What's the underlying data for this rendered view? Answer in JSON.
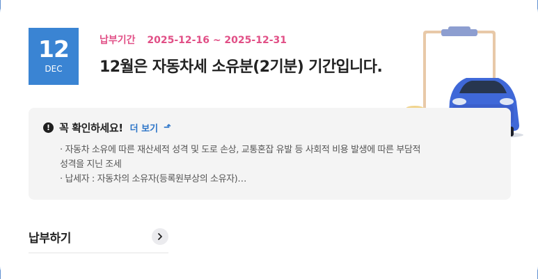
{
  "date": {
    "day": "12",
    "month": "DEC"
  },
  "period": {
    "label": "납부기간",
    "range": "2025-12-16 ~ 2025-12-31"
  },
  "headline": "12월은 자동차세 소유분(2기분) 기간입니다.",
  "notice": {
    "icon": "exclamation-circle-icon",
    "title": "꼭 확인하세요!",
    "more_label": "더 보기",
    "lines": [
      "· 자동차 소유에 따른 재산세적 성격 및 도로 손상, 교통혼잡 유발 등 사회적 비용 발생에 따른 부담적",
      "성격을 지닌 조세",
      "· 납세자 : 자동차의 소유자(등록원부상의 소유자)…"
    ]
  },
  "pay": {
    "label": "납부하기",
    "icon": "chevron-right-icon"
  },
  "colors": {
    "badge": "#3a84d3",
    "period_text": "#e14f86",
    "link": "#2b74c8",
    "notice_bg": "#f4f4f4"
  }
}
